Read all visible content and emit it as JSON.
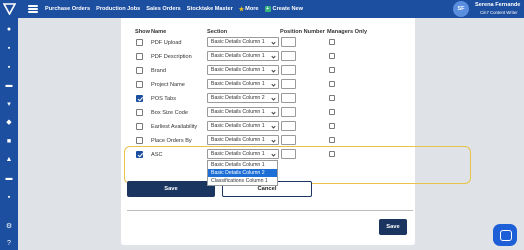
{
  "nav": {
    "items": [
      "Purchase Orders",
      "Production Jobs",
      "Sales Orders",
      "Stocktake Master",
      "More",
      "Create New"
    ]
  },
  "user": {
    "initials": "SF",
    "name": "Serena Fernande",
    "role": "Cin7 Content Writer"
  },
  "table": {
    "headers": {
      "show": "Show",
      "name": "Name",
      "section": "Section",
      "position": "Position Number",
      "managers": "Managers Only"
    },
    "rows": [
      {
        "name": "PDF Upload",
        "show": false,
        "section": "Basic Details Column 1"
      },
      {
        "name": "PDF Description",
        "show": false,
        "section": "Basic Details Column 1"
      },
      {
        "name": "Brand",
        "show": false,
        "section": "Basic Details Column 1"
      },
      {
        "name": "Project Name",
        "show": false,
        "section": "Basic Details Column 1"
      },
      {
        "name": "POS Tabs",
        "show": true,
        "section": "Basic Details Column 2"
      },
      {
        "name": "Box Size Code",
        "show": false,
        "section": "Basic Details Column 1"
      },
      {
        "name": "Earliest Availability",
        "show": false,
        "section": "Basic Details Column 1"
      },
      {
        "name": "Place Orders By",
        "show": false,
        "section": "Basic Details Column 1"
      },
      {
        "name": "ASC",
        "show": true,
        "section": "Basic Details Column 1"
      }
    ]
  },
  "dropdown": {
    "options": [
      "Basic Details Column 1",
      "Basic Details Column 2",
      "Classifications Column 1"
    ],
    "highlighted": "Basic Details Column 2"
  },
  "buttons": {
    "save": "Save",
    "cancel": "Cancel",
    "save_bottom": "Save"
  },
  "colors": {
    "brand_blue": "#1d4fa0",
    "button_navy": "#1a3560",
    "highlight_outline": "#e8c24a",
    "option_selected": "#1d6fd6"
  }
}
